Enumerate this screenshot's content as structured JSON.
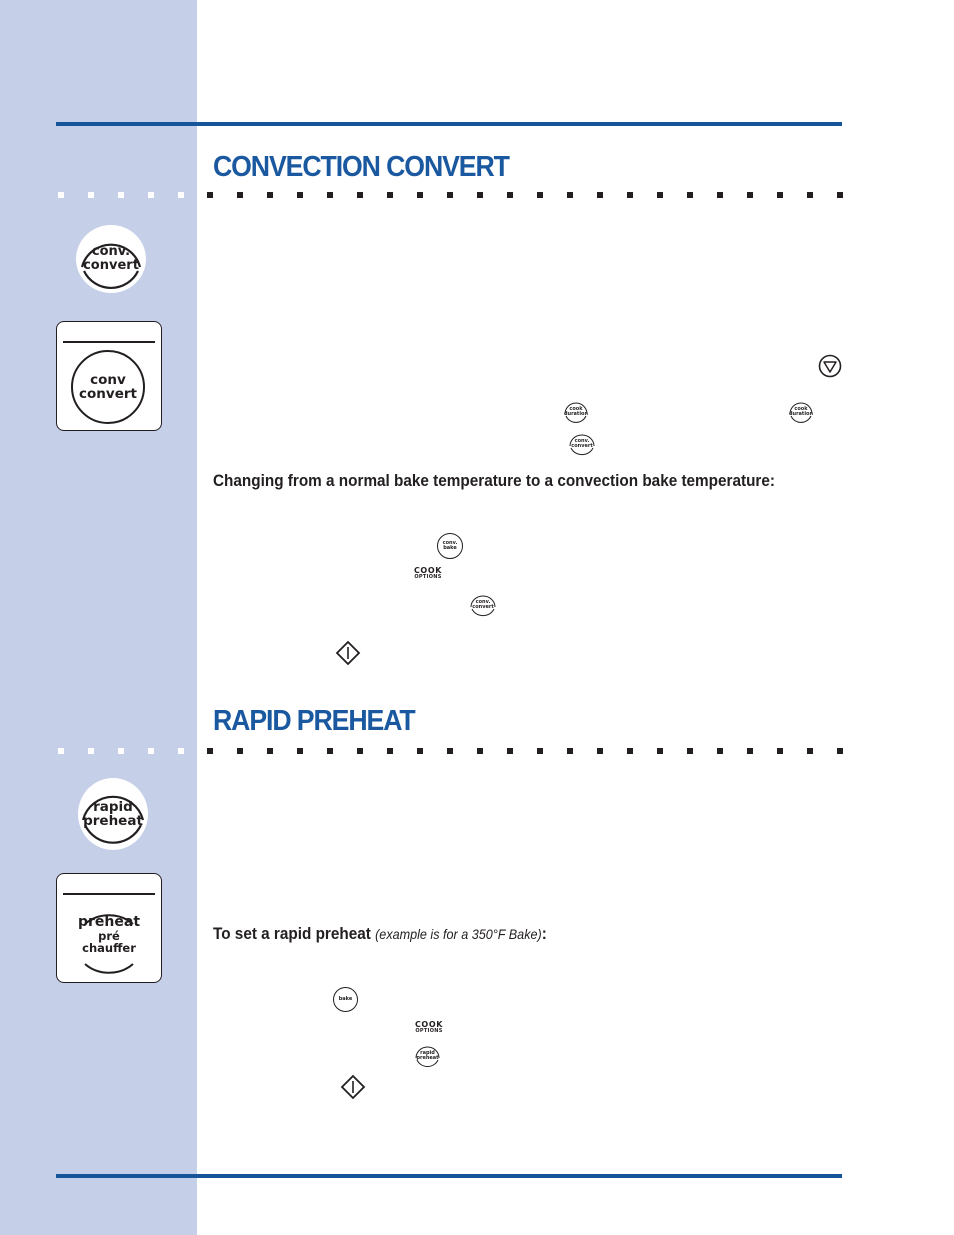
{
  "colors": {
    "sidebar": "#c5cfe8",
    "accent_blue": "#17559a",
    "title_blue": "#1a58a0",
    "text": "#231f20"
  },
  "sections": {
    "convection_convert": {
      "title": "CONVECTION CONVERT",
      "key_icon": {
        "label_line1": "conv.",
        "label_line2": "convert"
      },
      "panel_icon": {
        "label_line1": "conv",
        "label_line2": "convert"
      },
      "inline_icons": {
        "down_arrow": "down-arrow-key",
        "cook_duration_1": {
          "line1": "cook",
          "line2": "duration"
        },
        "cook_duration_2": {
          "line1": "cook",
          "line2": "duration"
        },
        "conv_convert_small": {
          "line1": "conv.",
          "line2": "convert"
        }
      },
      "subheading": "Changing from a normal bake temperature to a convection bake temperature:",
      "steps_icons": {
        "conv_bake": {
          "line1": "conv.",
          "line2": "bake"
        },
        "cook_options": {
          "line1": "COOK",
          "line2": "OPTIONS"
        },
        "conv_convert": {
          "line1": "conv.",
          "line2": "convert"
        },
        "start": "start-key"
      }
    },
    "rapid_preheat": {
      "title": "RAPID PREHEAT",
      "key_icon": {
        "label_line1": "rapid",
        "label_line2": "preheat"
      },
      "panel_icon": {
        "label_line1": "preheat",
        "label_line2": "pré",
        "label_line3": "chauffer"
      },
      "subheading_bold": "To set a rapid preheat ",
      "subheading_italic": "(example is for a 350°F Bake)",
      "subheading_end": ":",
      "steps_icons": {
        "bake": {
          "line1": "bake"
        },
        "cook_options": {
          "line1": "COOK",
          "line2": "OPTIONS"
        },
        "rapid_preheat": {
          "line1": "rapid",
          "line2": "preheat"
        },
        "start": "start-key"
      }
    }
  }
}
